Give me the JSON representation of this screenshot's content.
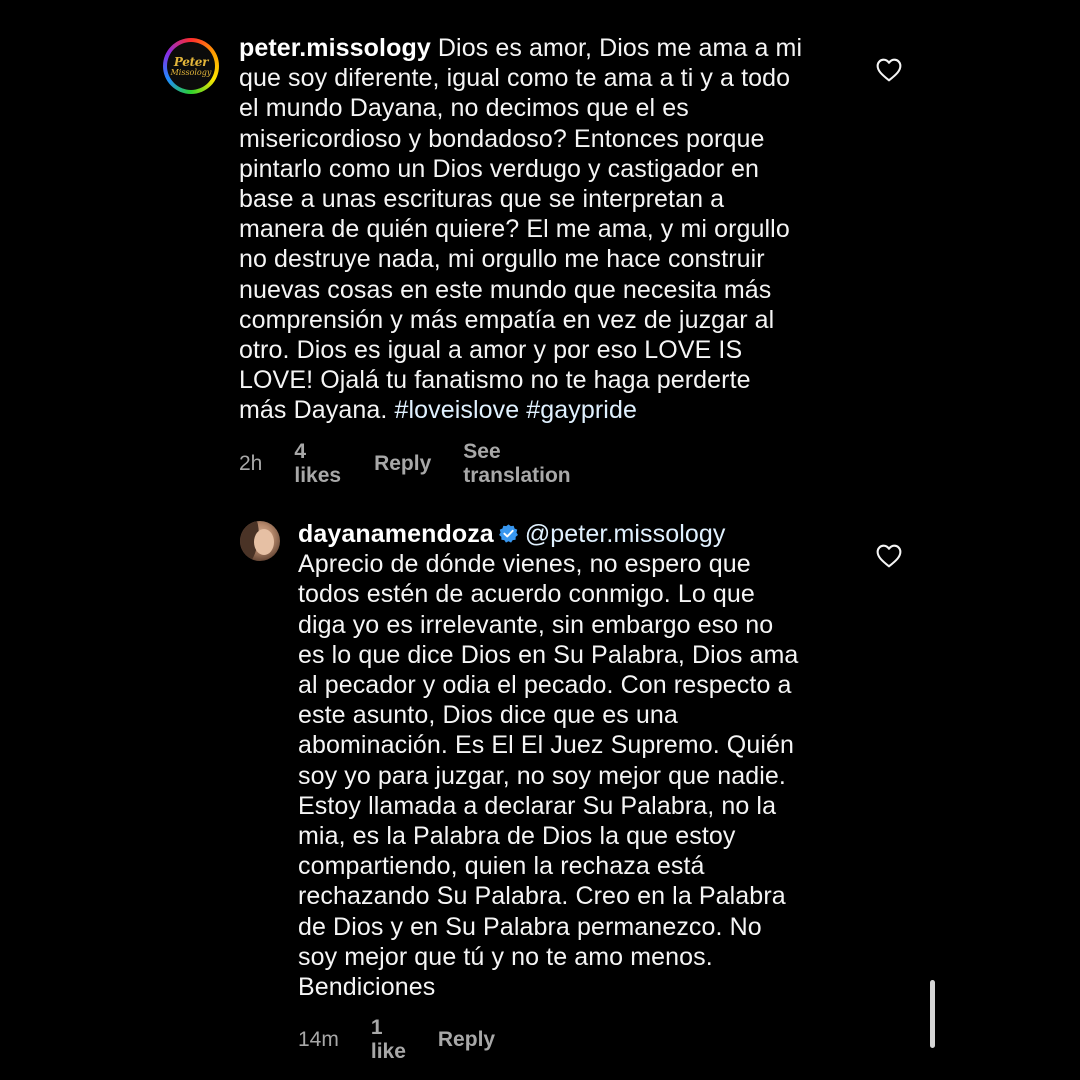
{
  "comments": [
    {
      "username": "peter.missology",
      "avatar_logo": "Peter",
      "avatar_logo_sub": "Missology",
      "lines": [
        "Dios es amor, Dios me ama a mi",
        "que soy diferente, igual como te ama a ti y a todo",
        "el mundo Dayana, no decimos que el es",
        "misericordioso y bondadoso? Entonces porque",
        "pintarlo como un Dios verdugo y castigador en",
        "base a unas escrituras que se interpretan a",
        "manera de quién quiere? El me ama, y mi orgullo",
        "no destruye nada, mi orgullo me hace construir",
        "nuevas cosas en este mundo que necesita más",
        "comprensión y más empatía en vez de juzgar al",
        "otro. Dios es igual a amor y por eso LOVE IS",
        "LOVE! Ojalá tu fanatismo no te haga perderte",
        "más Dayana."
      ],
      "hashtags": "#loveislove #gaypride",
      "time": "2h",
      "likes": "4 likes",
      "reply_label": "Reply",
      "translation_label": "See translation"
    },
    {
      "username": "dayanamendoza",
      "verified": true,
      "mention": "@peter.missology",
      "lines": [
        "Aprecio de dónde vienes, no espero que",
        "todos estén de acuerdo conmigo.  Lo que",
        "diga yo es irrelevante, sin embargo eso no",
        "es lo que dice Dios en Su Palabra, Dios ama",
        "al pecador y odia el pecado. Con  respecto a",
        "este asunto, Dios dice que es una",
        "abominación.  Es El El Juez Supremo. Quién",
        "soy yo para juzgar, no soy mejor que nadie.",
        "Estoy llamada a declarar Su Palabra, no la",
        "mia, es la Palabra de Dios la que estoy",
        "compartiendo, quien la rechaza está",
        "rechazando Su Palabra.  Creo en la Palabra",
        "de Dios y en Su Palabra permanezco.  No",
        "soy mejor que tú y no te amo menos.",
        "Bendiciones"
      ],
      "time": "14m",
      "likes": "1 like",
      "reply_label": "Reply"
    }
  ],
  "icons": {
    "like": "heart-outline-icon",
    "verified": "verified-badge-icon"
  },
  "colors": {
    "background": "#000000",
    "text": "#f5f5f5",
    "meta": "#a8a8a8",
    "verified_blue": "#3897f0"
  }
}
